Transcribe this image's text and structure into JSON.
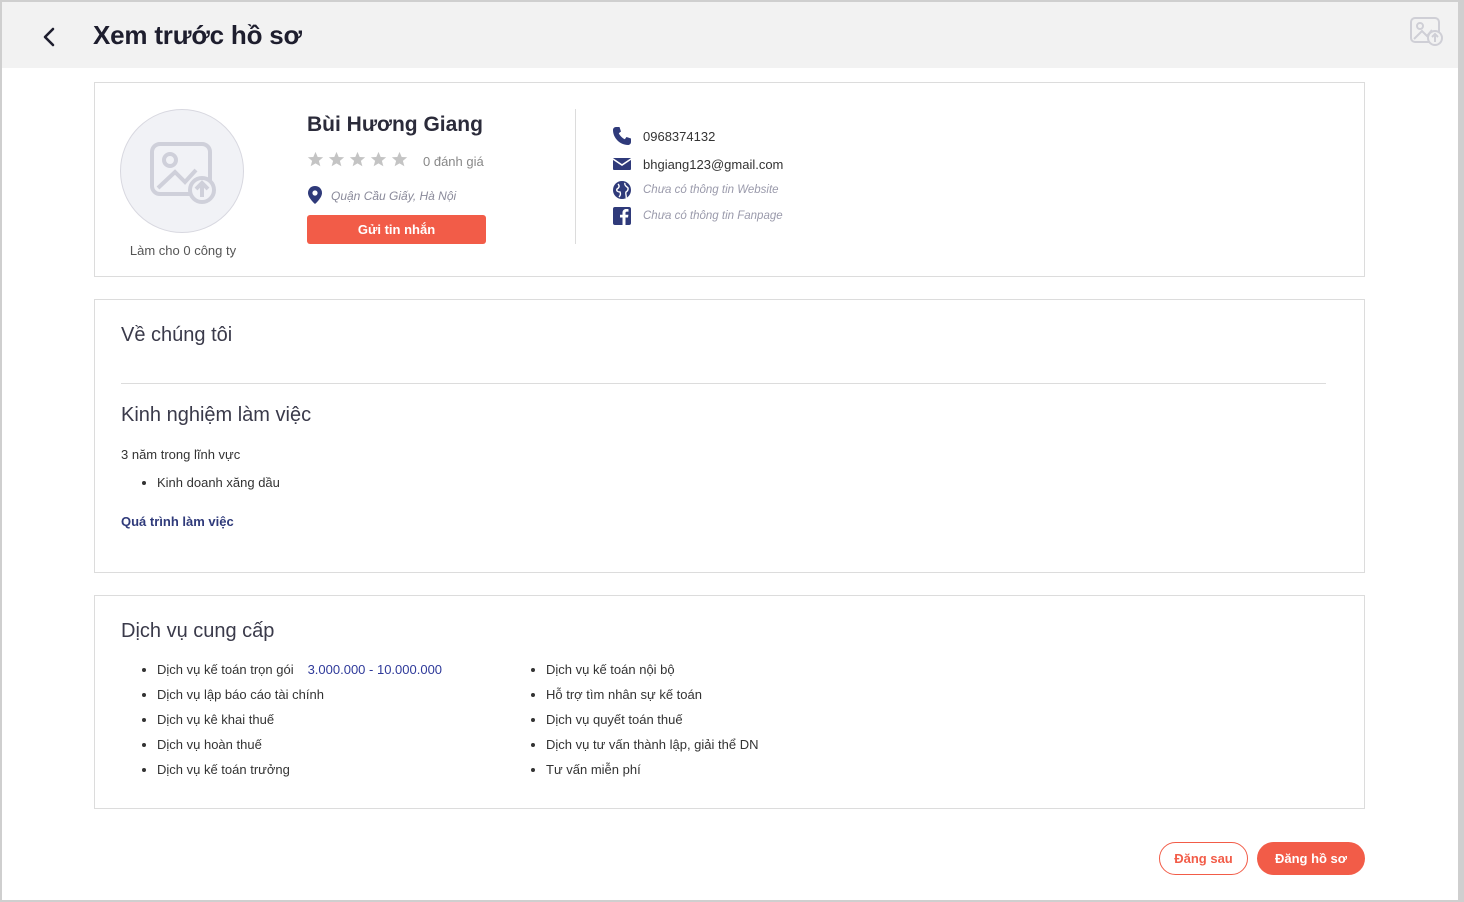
{
  "header": {
    "title": "Xem trước hồ sơ",
    "back_icon": "chevron-left-icon",
    "right_icon": "image-upload-icon"
  },
  "profile": {
    "avatar_icon": "image-upload-icon",
    "works_for": "Làm cho 0 công ty",
    "name": "Bùi Hương Giang",
    "rating_stars": 0,
    "rating_max": 5,
    "rating_text": "0 đánh giá",
    "location": "Quận Cầu Giấy, Hà Nội",
    "send_message_label": "Gửi tin nhắn"
  },
  "contact": {
    "phone": "0968374132",
    "email": "bhgiang123@gmail.com",
    "website": "Chưa có thông tin Website",
    "fanpage": "Chưa có thông tin Fanpage"
  },
  "about": {
    "title": "Về chúng tôi",
    "experience_title": "Kinh nghiệm làm việc",
    "years": "3 năm trong lĩnh vực",
    "fields": [
      "Kinh doanh xăng dầu"
    ],
    "work_history_link": "Quá trình làm việc"
  },
  "services": {
    "title": "Dịch vụ cung cấp",
    "left": [
      {
        "name": "Dịch vụ kế toán trọn gói",
        "price": "3.000.000 - 10.000.000"
      },
      {
        "name": "Dịch vụ lập báo cáo tài chính",
        "price": ""
      },
      {
        "name": "Dịch vụ kê khai thuế",
        "price": ""
      },
      {
        "name": "Dịch vụ hoàn thuế",
        "price": ""
      },
      {
        "name": "Dịch vụ kế toán trưởng",
        "price": ""
      }
    ],
    "right": [
      "Dịch vụ kế toán nội bộ",
      "Hỗ trợ tìm nhân sự kế toán",
      "Dịch vụ quyết toán thuế",
      "Dịch vụ tư vấn thành lập, giải thể DN",
      "Tư vấn miễn phí"
    ]
  },
  "actions": {
    "later_label": "Đăng sau",
    "post_label": "Đăng hồ sơ"
  },
  "colors": {
    "accent": "#f25c48",
    "icon_navy": "#2f3a7a",
    "star_gray": "#c4c4c4"
  }
}
